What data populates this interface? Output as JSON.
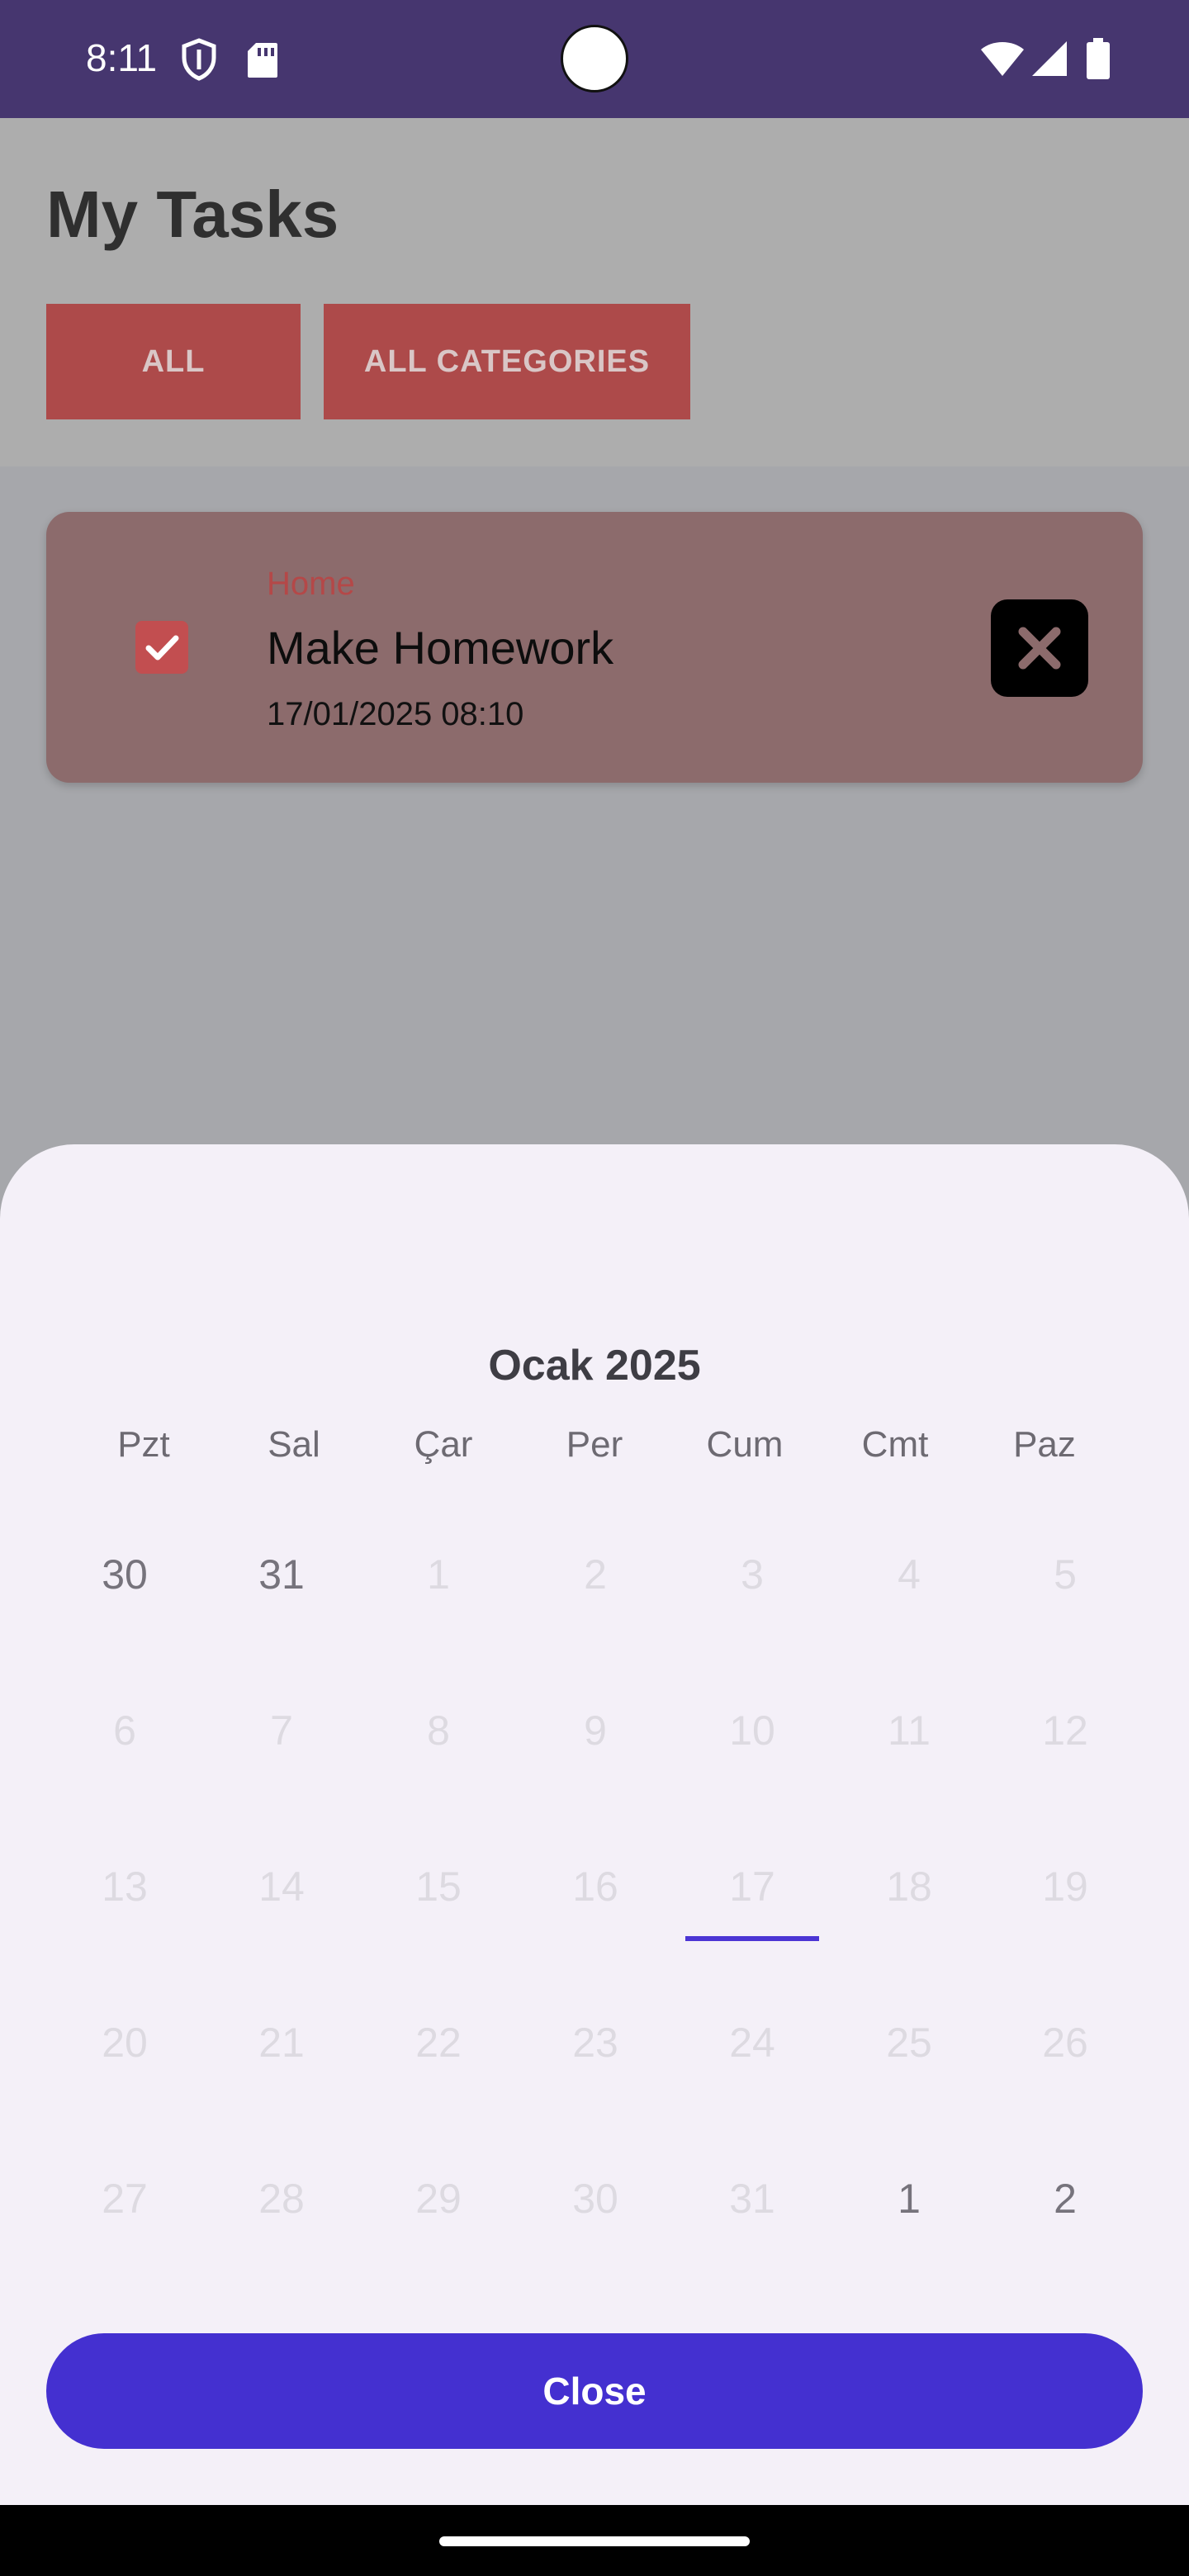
{
  "status_bar": {
    "time": "8:11",
    "left_icons": [
      "shield-icon",
      "sd-card-icon"
    ],
    "right_icons": [
      "wifi-icon",
      "cell-signal-icon",
      "battery-icon"
    ]
  },
  "header": {
    "title": "My Tasks",
    "filters": [
      {
        "label": "ALL"
      },
      {
        "label": "ALL CATEGORIES"
      }
    ]
  },
  "tasks": [
    {
      "category": "Home",
      "title": "Make Homework",
      "datetime": "17/01/2025 08:10",
      "completed": true
    }
  ],
  "calendar": {
    "month_title": "Ocak 2025",
    "weekdays": [
      "Pzt",
      "Sal",
      "Çar",
      "Per",
      "Cum",
      "Cmt",
      "Paz"
    ],
    "weeks": [
      [
        "30",
        "31",
        "1",
        "2",
        "3",
        "4",
        "5"
      ],
      [
        "6",
        "7",
        "8",
        "9",
        "10",
        "11",
        "12"
      ],
      [
        "13",
        "14",
        "15",
        "16",
        "17",
        "18",
        "19"
      ],
      [
        "20",
        "21",
        "22",
        "23",
        "24",
        "25",
        "26"
      ],
      [
        "27",
        "28",
        "29",
        "30",
        "31",
        "1",
        "2"
      ]
    ],
    "selected_day": "17",
    "close_label": "Close"
  },
  "colors": {
    "accent": "#4430d0",
    "status_bar": "#46366f",
    "filter_button": "#ad4a4a",
    "task_card": "#8c6b6c",
    "sheet_background": "#f4f0f8"
  }
}
